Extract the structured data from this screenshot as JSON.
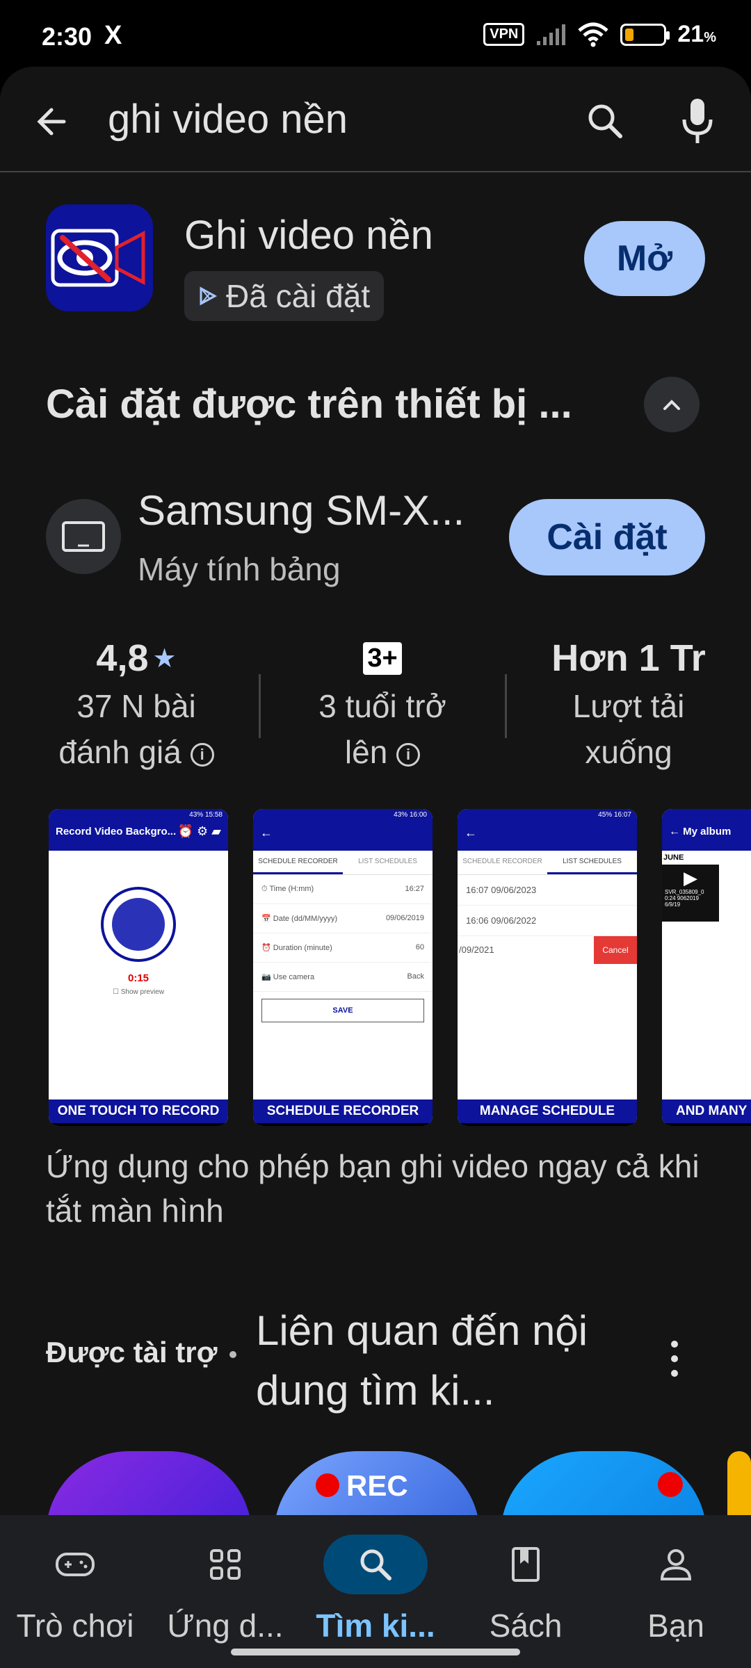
{
  "status_bar": {
    "time": "2:30",
    "x_logo": "X",
    "vpn": "VPN",
    "battery_pct": "21",
    "pct_sign": "%"
  },
  "search": {
    "query": "ghi video nền"
  },
  "app": {
    "name": "Ghi video nền",
    "installed_label": "Đã cài đặt",
    "open_label": "Mở"
  },
  "install_section": {
    "title": "Cài đặt được trên thiết bị ...",
    "device_name": "Samsung SM-X...",
    "device_type": "Máy tính bảng",
    "install_label": "Cài đặt"
  },
  "stats": {
    "rating": "4,8",
    "reviews_line1": "37 N bài",
    "reviews_line2": "đánh giá",
    "age_badge": "3+",
    "age_line1": "3 tuổi trở",
    "age_line2": "lên",
    "downloads": "Hơn 1 Tr",
    "downloads_line1": "Lượt tải",
    "downloads_line2": "xuống"
  },
  "screenshots": {
    "s1_title": "Record Video Backgro...",
    "s1_timer": "0:15",
    "s1_preview": "Show preview",
    "s1_caption": "ONE TOUCH TO RECORD",
    "s1_status": "43% 15:58",
    "s2_status": "43% 16:00",
    "s2_tab1": "SCHEDULE RECORDER",
    "s2_tab2": "LIST SCHEDULES",
    "s2_rows": [
      {
        "label": "Time (H:mm)",
        "value": "16:27"
      },
      {
        "label": "Date (dd/MM/yyyy)",
        "value": "09/06/2019"
      },
      {
        "label": "Duration (minute)",
        "value": "60"
      },
      {
        "label": "Use camera",
        "value": "Back"
      }
    ],
    "s2_save": "SAVE",
    "s2_caption": "SCHEDULE RECORDER",
    "s3_status": "45% 16:07",
    "s3_tab1": "SCHEDULE RECORDER",
    "s3_tab2": "LIST SCHEDULES",
    "s3_items": [
      "16:07 09/06/2023",
      "16:06 09/06/2022",
      "/09/2021"
    ],
    "s3_cancel": "Cancel",
    "s3_caption": "MANAGE SCHEDULE",
    "s4_title": "My album",
    "s4_month": "JUNE",
    "s4_file": "SVR_035809_0",
    "s4_meta": "0:24 9062019",
    "s4_date": "6/9/19",
    "s4_caption": "AND MANY"
  },
  "description": "Ứng dụng cho phép bạn ghi video ngay cả khi tắt màn hình",
  "sponsored": {
    "label": "Được tài trợ",
    "title": "Liên quan đến nội dung tìm ki...",
    "rec_label": "REC"
  },
  "nav": [
    {
      "label": "Trò chơi",
      "icon": "gamepad-icon"
    },
    {
      "label": "Ứng d...",
      "icon": "apps-grid-icon"
    },
    {
      "label": "Tìm ki...",
      "icon": "search-icon"
    },
    {
      "label": "Sách",
      "icon": "book-icon"
    },
    {
      "label": "Bạn",
      "icon": "person-icon"
    }
  ],
  "colors": {
    "accent": "#a8c7fa",
    "active_nav": "#004a77",
    "app_blue": "#0d139a",
    "surface": "#141414"
  }
}
